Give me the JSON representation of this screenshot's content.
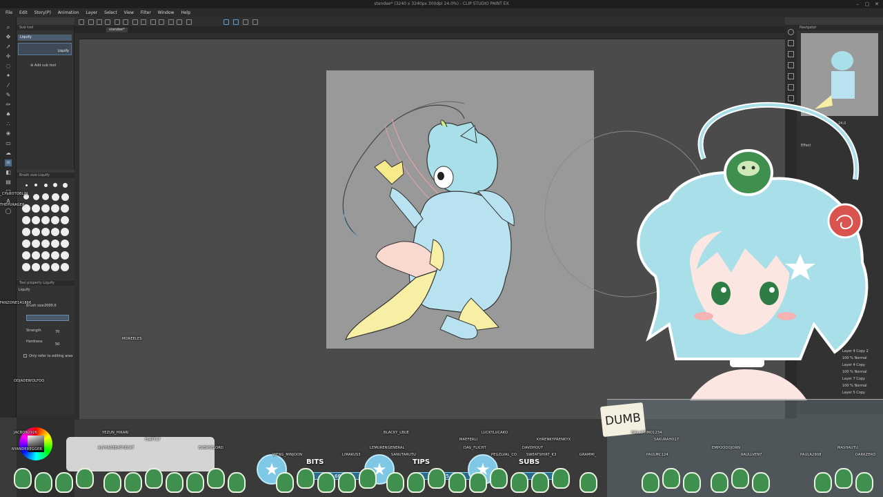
{
  "app": {
    "window_title": "standee* (3240 x 3240px 300dpi 24.0%) - CLIP STUDIO PAINT EX"
  },
  "menu": [
    "File",
    "Edit",
    "Story(P)",
    "Animation",
    "Layer",
    "Select",
    "View",
    "Filter",
    "Window",
    "Help"
  ],
  "tabs": [
    "standee*"
  ],
  "subtool_panel": {
    "header": "Sub tool",
    "group": "Liquify",
    "selected": "Liquify",
    "add_sub_tool": "Add sub tool"
  },
  "brush_size_panel": {
    "header": "Brush size Liquify"
  },
  "tool_property": {
    "header": "Tool property Liquify",
    "tool": "Liquify",
    "brush_size_label": "Brush size",
    "brush_size_value": "2000.0",
    "strength_label": "Strength",
    "strength_value": "70",
    "hardness_label": "Hardness",
    "hardness_value": "50",
    "only_refer_label": "Only refer to editing area"
  },
  "navigator": {
    "header": "Navigator",
    "zoom": "24.0",
    "effect_label": "Effect"
  },
  "layers": [
    "Layer 4 Copy 2",
    "100 % Normal",
    "Layer 4 Copy",
    "100 % Normal",
    "Layer 7 Copy",
    "100 % Normal",
    "Layer 5 Copy"
  ],
  "stream_overlay": {
    "note_text": "DUMB",
    "goals": [
      {
        "label": "BITS",
        "value": "666"
      },
      {
        "label": "TIPS",
        "value": "€5"
      },
      {
        "label": "SUBS",
        "value": ""
      }
    ],
    "chat_names": [
      "_CYLOOTOBLIN",
      "THEPURAGER",
      "FANZONE141866",
      "ODJADEWOLFOO",
      "MOREELES",
      "JACBON2926",
      "NYANDEREGGER",
      "YEZUN_HIKARI",
      "FLATT17",
      "ALPHADEBATHECAT",
      "EVERNELORD",
      "WENG_MINJOON",
      "LIMAKUS3",
      "BLACKY_LBUE",
      "LEMURENGENERAL",
      "SANUTARUTU",
      "LUCKYLUCAKO",
      "MAEFERLI",
      "DAG_FLICHT",
      "PEGZLVAL_CO",
      "DAVDHOUT",
      "KHRENKYPRENKYX",
      "SWEATSHIRT_K3",
      "GRAMMI_",
      "HALLOTIMO1234",
      "SAKURAHO17",
      "EMPOOOOJORN",
      "PAULMC124",
      "RAULLVEN7",
      "PAULA2908",
      "MASHAUTU",
      "DARKZERO"
    ]
  },
  "colors": {
    "accent": "#5aa0d8",
    "canvas_bg": "#4b4b4b",
    "artboard_bg": "#999999",
    "hair": "#a9dfe8",
    "hoodie": "#b8e2f0",
    "legs": "#f7f0a4"
  }
}
